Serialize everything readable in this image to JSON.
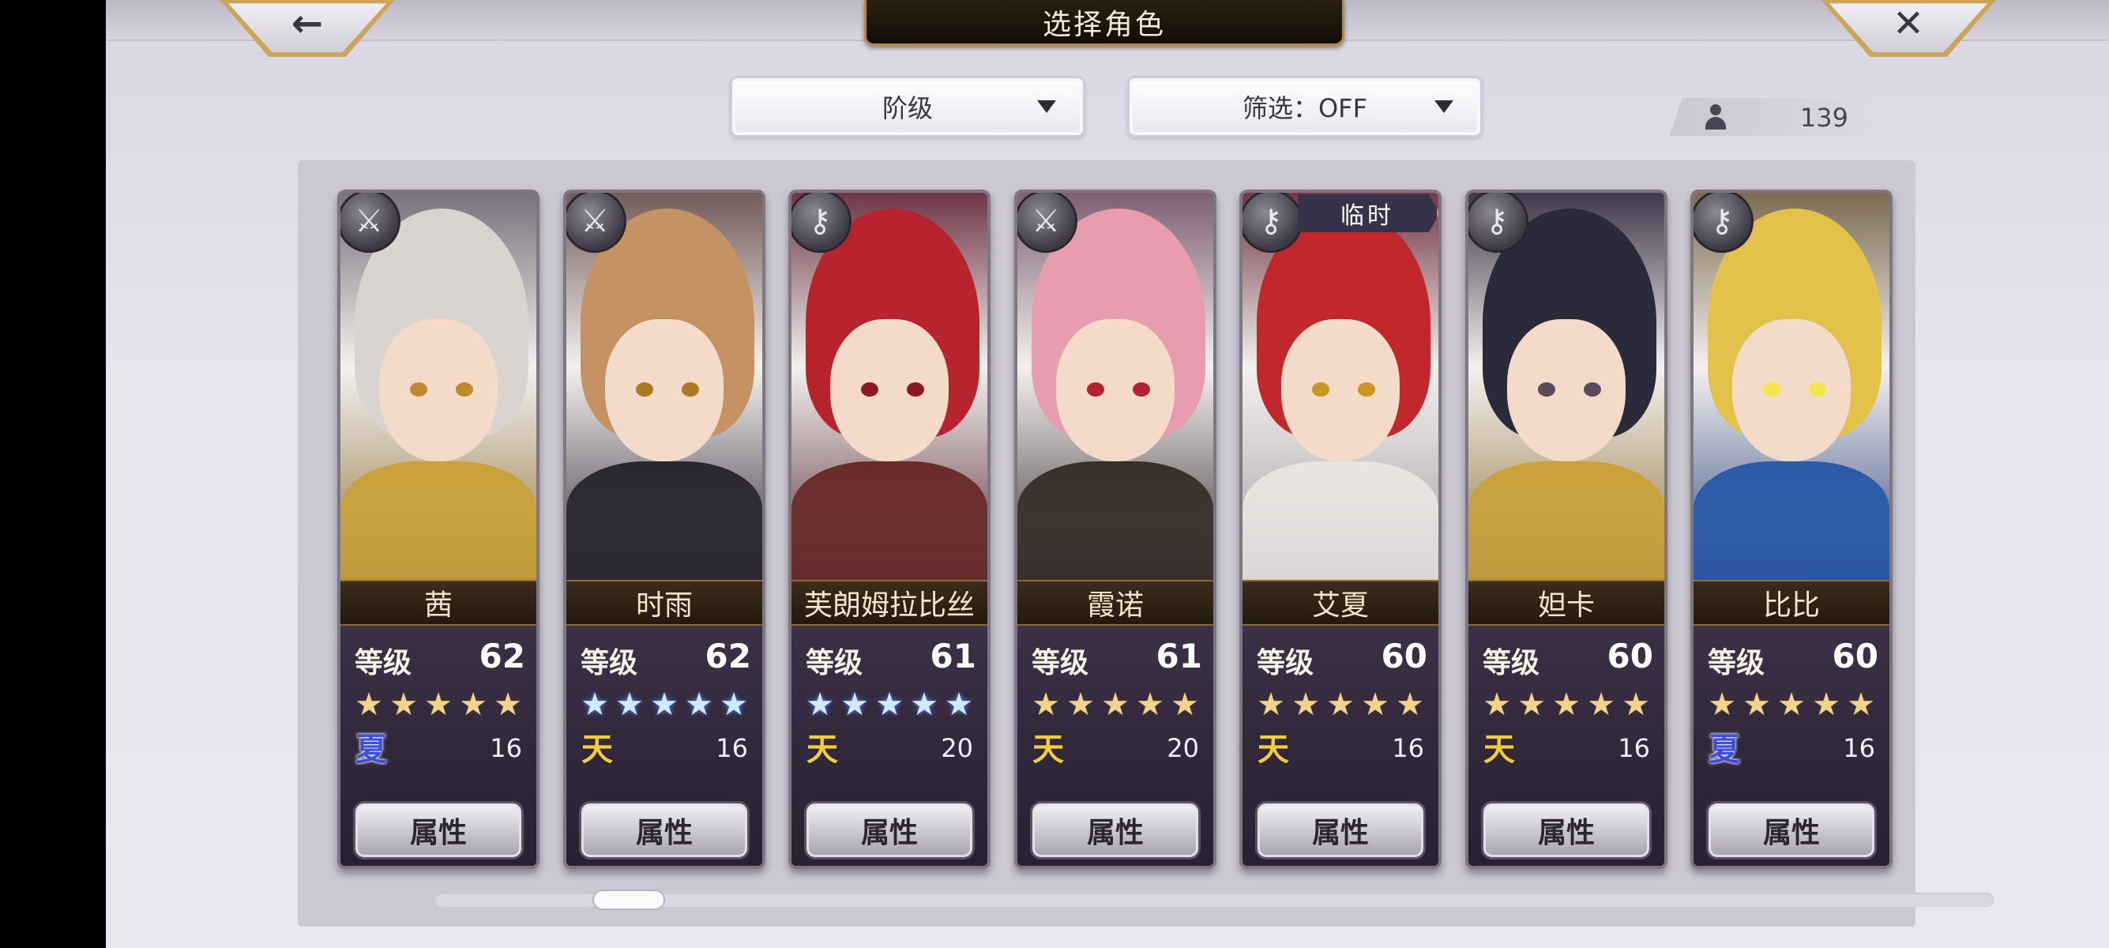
{
  "header": {
    "title": "选择角色",
    "back_glyph": "←",
    "close_glyph": "✕"
  },
  "filters": {
    "rank_label": "阶级",
    "filter_label": "筛选：OFF"
  },
  "owned_count": "139",
  "attr_button_label": "属性",
  "level_label": "等级",
  "characters": [
    {
      "name": "茜",
      "level": "62",
      "stars": 5,
      "star_style": "gold",
      "element": "夏",
      "element_type": "summer",
      "value": "16",
      "class_icon": "sword-icon",
      "class_glyph": "⚔",
      "hair": "#d9d4cf",
      "eyes": "#c08a2c",
      "outfit": "#c9a23a"
    },
    {
      "name": "时雨",
      "level": "62",
      "stars": 5,
      "star_style": "blue",
      "element": "天",
      "element_type": "sky",
      "value": "16",
      "class_icon": "sword-icon",
      "class_glyph": "⚔",
      "hair": "#c49263",
      "eyes": "#a97a22",
      "outfit": "#2a2630"
    },
    {
      "name": "芙朗姆拉比丝",
      "level": "61",
      "stars": 5,
      "star_style": "blue",
      "element": "天",
      "element_type": "sky",
      "value": "20",
      "class_icon": "key-icon",
      "class_glyph": "⚷",
      "hair": "#b8242e",
      "eyes": "#8c1a22",
      "outfit": "#6a2a2a"
    },
    {
      "name": "霞诺",
      "level": "61",
      "stars": 5,
      "star_style": "gold",
      "element": "天",
      "element_type": "sky",
      "value": "20",
      "class_icon": "sword-icon",
      "class_glyph": "⚔",
      "hair": "#e89cb0",
      "eyes": "#b42034",
      "outfit": "#3a2e2a"
    },
    {
      "name": "艾夏",
      "level": "60",
      "stars": 5,
      "star_style": "gold",
      "element": "天",
      "element_type": "sky",
      "value": "16",
      "class_icon": "key-icon",
      "class_glyph": "⚷",
      "hair": "#c2282b",
      "eyes": "#c9961f",
      "outfit": "#e8e4e2",
      "badge": "临时"
    },
    {
      "name": "妲卡",
      "level": "60",
      "stars": 5,
      "star_style": "gold",
      "element": "天",
      "element_type": "sky",
      "value": "16",
      "class_icon": "key-icon",
      "class_glyph": "⚷",
      "hair": "#2a2a3a",
      "eyes": "#5a4a5a",
      "outfit": "#c9a23a"
    },
    {
      "name": "比比",
      "level": "60",
      "stars": 5,
      "star_style": "gold",
      "element": "夏",
      "element_type": "summer",
      "value": "16",
      "class_icon": "key-icon",
      "class_glyph": "⚷",
      "hair": "#e2c24a",
      "eyes": "#f2e64a",
      "outfit": "#2a5aa8"
    }
  ],
  "scrollbar": {
    "position_fraction": 0.1
  }
}
